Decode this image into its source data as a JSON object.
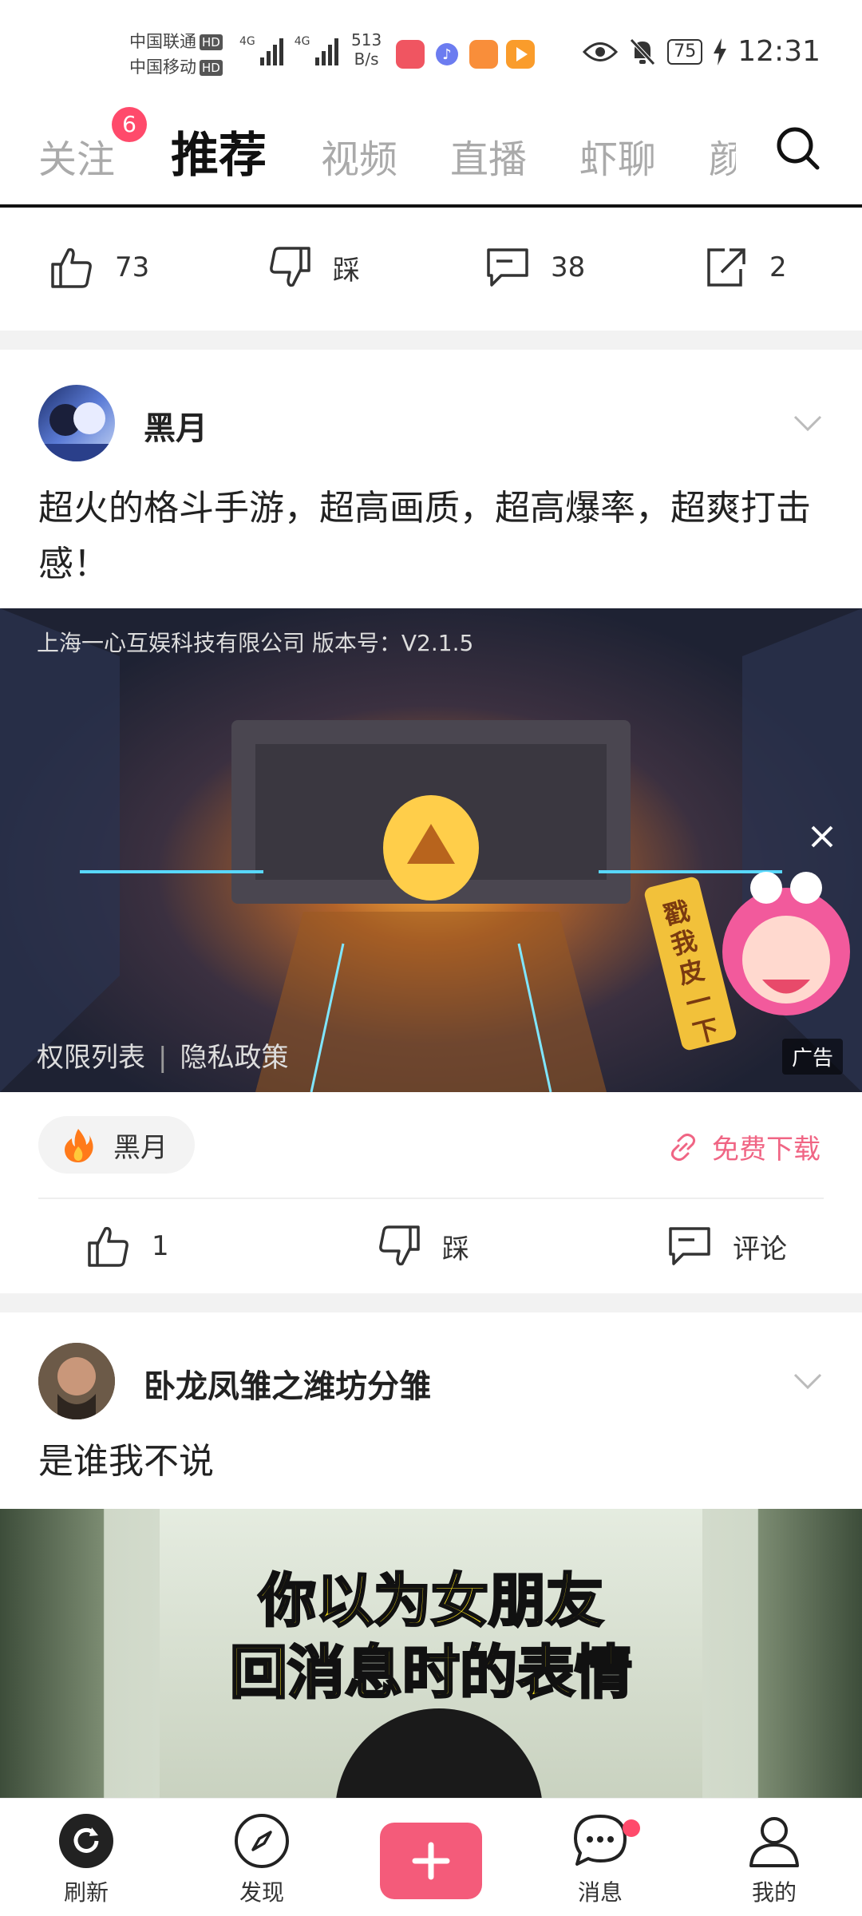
{
  "status_bar": {
    "carrier_1": "中国联通",
    "carrier_2": "中国移动",
    "hd": "HD",
    "net_type": "4G",
    "net_speed_value": "513",
    "net_speed_unit": "B/s",
    "battery": "75",
    "time": "12:31"
  },
  "tabs": {
    "items": [
      "关注",
      "推荐",
      "视频",
      "直播",
      "虾聊",
      "颜"
    ],
    "active": "推荐",
    "follow_badge": "6"
  },
  "post_prev": {
    "likes": "73",
    "dislike_label": "踩",
    "comments": "38",
    "shares": "2"
  },
  "ad_post": {
    "author": "黑月",
    "text": "超火的格斗手游，超高画质，超高爆率，超爽打击感！",
    "company_line": "上海一心互娱科技有限公司   版本号：V2.1.5",
    "permissions": "权限列表",
    "privacy": "隐私政策",
    "ad_tag": "广告",
    "sticker_text": "戳我皮一下",
    "pill_name": "黑月",
    "download_label": "免费下载",
    "likes": "1",
    "dislike_label": "踩",
    "comment_label": "评论"
  },
  "post_next": {
    "author": "卧龙凤雏之潍坊分雏",
    "text": "是谁我不说",
    "caption_line1": "你以为女朋友",
    "caption_line2": "回消息时的表情"
  },
  "bottom_nav": {
    "refresh": "刷新",
    "discover": "发现",
    "messages": "消息",
    "me": "我的"
  },
  "colors": {
    "accent": "#f45b7a",
    "badge": "#ff4a6b",
    "download": "#f06584"
  }
}
